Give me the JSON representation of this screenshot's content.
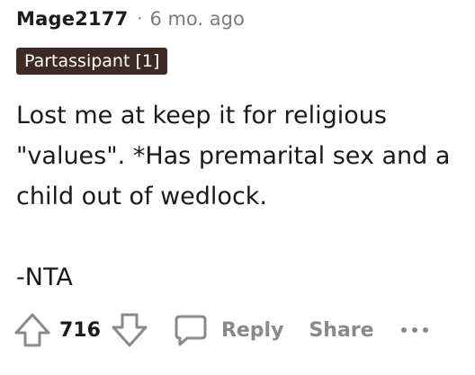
{
  "comment": {
    "username": "Mage2177",
    "separator": "·",
    "timestamp": "6 mo. ago",
    "flair": "Partassipant [1]",
    "body_lines": [
      "Lost me at keep it for religious \"values\". *Has premarital sex and a child out of wedlock."
    ],
    "signoff": "-NTA"
  },
  "actions": {
    "vote_count": "716",
    "reply_label": "Reply",
    "share_label": "Share",
    "more_label": "•••",
    "icons": {
      "upvote": "upvote-arrow-icon",
      "downvote": "downvote-arrow-icon",
      "reply": "speech-bubble-icon",
      "more": "more-dots-icon"
    }
  },
  "colors": {
    "flair_bg": "#3d2b23",
    "muted_text": "#878a8c",
    "text": "#1a1a1b"
  }
}
